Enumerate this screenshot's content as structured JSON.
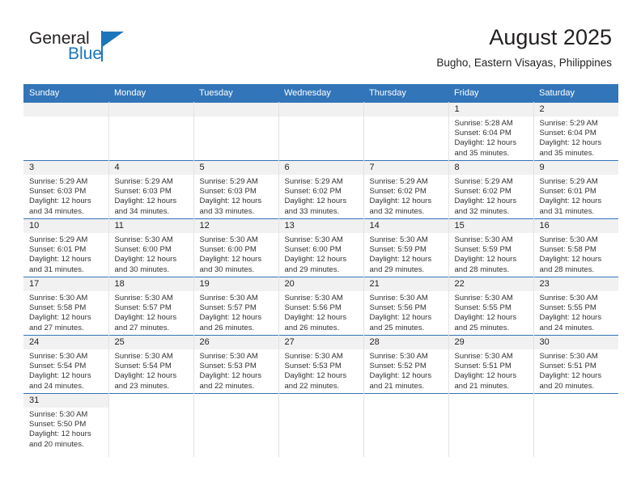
{
  "brand": {
    "name_part1": "General",
    "name_part2": "Blue",
    "logo_icon": "triangle-flag-icon",
    "accent_color": "#1b75bb"
  },
  "header": {
    "title": "August 2025",
    "subtitle": "Bugho, Eastern Visayas, Philippines"
  },
  "theme": {
    "header_row_bg": "#3275b8",
    "daynum_band_bg": "#f1f1f1",
    "grid_line": "#3275b8",
    "text": "#231f20"
  },
  "calendar": {
    "weekday_headers": [
      "Sunday",
      "Monday",
      "Tuesday",
      "Wednesday",
      "Thursday",
      "Friday",
      "Saturday"
    ],
    "weeks": [
      [
        {
          "day": "",
          "empty": true
        },
        {
          "day": "",
          "empty": true
        },
        {
          "day": "",
          "empty": true
        },
        {
          "day": "",
          "empty": true
        },
        {
          "day": "",
          "empty": true
        },
        {
          "day": "1",
          "sunrise": "Sunrise: 5:28 AM",
          "sunset": "Sunset: 6:04 PM",
          "daylight1": "Daylight: 12 hours",
          "daylight2": "and 35 minutes."
        },
        {
          "day": "2",
          "sunrise": "Sunrise: 5:29 AM",
          "sunset": "Sunset: 6:04 PM",
          "daylight1": "Daylight: 12 hours",
          "daylight2": "and 35 minutes."
        }
      ],
      [
        {
          "day": "3",
          "sunrise": "Sunrise: 5:29 AM",
          "sunset": "Sunset: 6:03 PM",
          "daylight1": "Daylight: 12 hours",
          "daylight2": "and 34 minutes."
        },
        {
          "day": "4",
          "sunrise": "Sunrise: 5:29 AM",
          "sunset": "Sunset: 6:03 PM",
          "daylight1": "Daylight: 12 hours",
          "daylight2": "and 34 minutes."
        },
        {
          "day": "5",
          "sunrise": "Sunrise: 5:29 AM",
          "sunset": "Sunset: 6:03 PM",
          "daylight1": "Daylight: 12 hours",
          "daylight2": "and 33 minutes."
        },
        {
          "day": "6",
          "sunrise": "Sunrise: 5:29 AM",
          "sunset": "Sunset: 6:02 PM",
          "daylight1": "Daylight: 12 hours",
          "daylight2": "and 33 minutes."
        },
        {
          "day": "7",
          "sunrise": "Sunrise: 5:29 AM",
          "sunset": "Sunset: 6:02 PM",
          "daylight1": "Daylight: 12 hours",
          "daylight2": "and 32 minutes."
        },
        {
          "day": "8",
          "sunrise": "Sunrise: 5:29 AM",
          "sunset": "Sunset: 6:02 PM",
          "daylight1": "Daylight: 12 hours",
          "daylight2": "and 32 minutes."
        },
        {
          "day": "9",
          "sunrise": "Sunrise: 5:29 AM",
          "sunset": "Sunset: 6:01 PM",
          "daylight1": "Daylight: 12 hours",
          "daylight2": "and 31 minutes."
        }
      ],
      [
        {
          "day": "10",
          "sunrise": "Sunrise: 5:29 AM",
          "sunset": "Sunset: 6:01 PM",
          "daylight1": "Daylight: 12 hours",
          "daylight2": "and 31 minutes."
        },
        {
          "day": "11",
          "sunrise": "Sunrise: 5:30 AM",
          "sunset": "Sunset: 6:00 PM",
          "daylight1": "Daylight: 12 hours",
          "daylight2": "and 30 minutes."
        },
        {
          "day": "12",
          "sunrise": "Sunrise: 5:30 AM",
          "sunset": "Sunset: 6:00 PM",
          "daylight1": "Daylight: 12 hours",
          "daylight2": "and 30 minutes."
        },
        {
          "day": "13",
          "sunrise": "Sunrise: 5:30 AM",
          "sunset": "Sunset: 6:00 PM",
          "daylight1": "Daylight: 12 hours",
          "daylight2": "and 29 minutes."
        },
        {
          "day": "14",
          "sunrise": "Sunrise: 5:30 AM",
          "sunset": "Sunset: 5:59 PM",
          "daylight1": "Daylight: 12 hours",
          "daylight2": "and 29 minutes."
        },
        {
          "day": "15",
          "sunrise": "Sunrise: 5:30 AM",
          "sunset": "Sunset: 5:59 PM",
          "daylight1": "Daylight: 12 hours",
          "daylight2": "and 28 minutes."
        },
        {
          "day": "16",
          "sunrise": "Sunrise: 5:30 AM",
          "sunset": "Sunset: 5:58 PM",
          "daylight1": "Daylight: 12 hours",
          "daylight2": "and 28 minutes."
        }
      ],
      [
        {
          "day": "17",
          "sunrise": "Sunrise: 5:30 AM",
          "sunset": "Sunset: 5:58 PM",
          "daylight1": "Daylight: 12 hours",
          "daylight2": "and 27 minutes."
        },
        {
          "day": "18",
          "sunrise": "Sunrise: 5:30 AM",
          "sunset": "Sunset: 5:57 PM",
          "daylight1": "Daylight: 12 hours",
          "daylight2": "and 27 minutes."
        },
        {
          "day": "19",
          "sunrise": "Sunrise: 5:30 AM",
          "sunset": "Sunset: 5:57 PM",
          "daylight1": "Daylight: 12 hours",
          "daylight2": "and 26 minutes."
        },
        {
          "day": "20",
          "sunrise": "Sunrise: 5:30 AM",
          "sunset": "Sunset: 5:56 PM",
          "daylight1": "Daylight: 12 hours",
          "daylight2": "and 26 minutes."
        },
        {
          "day": "21",
          "sunrise": "Sunrise: 5:30 AM",
          "sunset": "Sunset: 5:56 PM",
          "daylight1": "Daylight: 12 hours",
          "daylight2": "and 25 minutes."
        },
        {
          "day": "22",
          "sunrise": "Sunrise: 5:30 AM",
          "sunset": "Sunset: 5:55 PM",
          "daylight1": "Daylight: 12 hours",
          "daylight2": "and 25 minutes."
        },
        {
          "day": "23",
          "sunrise": "Sunrise: 5:30 AM",
          "sunset": "Sunset: 5:55 PM",
          "daylight1": "Daylight: 12 hours",
          "daylight2": "and 24 minutes."
        }
      ],
      [
        {
          "day": "24",
          "sunrise": "Sunrise: 5:30 AM",
          "sunset": "Sunset: 5:54 PM",
          "daylight1": "Daylight: 12 hours",
          "daylight2": "and 24 minutes."
        },
        {
          "day": "25",
          "sunrise": "Sunrise: 5:30 AM",
          "sunset": "Sunset: 5:54 PM",
          "daylight1": "Daylight: 12 hours",
          "daylight2": "and 23 minutes."
        },
        {
          "day": "26",
          "sunrise": "Sunrise: 5:30 AM",
          "sunset": "Sunset: 5:53 PM",
          "daylight1": "Daylight: 12 hours",
          "daylight2": "and 22 minutes."
        },
        {
          "day": "27",
          "sunrise": "Sunrise: 5:30 AM",
          "sunset": "Sunset: 5:53 PM",
          "daylight1": "Daylight: 12 hours",
          "daylight2": "and 22 minutes."
        },
        {
          "day": "28",
          "sunrise": "Sunrise: 5:30 AM",
          "sunset": "Sunset: 5:52 PM",
          "daylight1": "Daylight: 12 hours",
          "daylight2": "and 21 minutes."
        },
        {
          "day": "29",
          "sunrise": "Sunrise: 5:30 AM",
          "sunset": "Sunset: 5:51 PM",
          "daylight1": "Daylight: 12 hours",
          "daylight2": "and 21 minutes."
        },
        {
          "day": "30",
          "sunrise": "Sunrise: 5:30 AM",
          "sunset": "Sunset: 5:51 PM",
          "daylight1": "Daylight: 12 hours",
          "daylight2": "and 20 minutes."
        }
      ],
      [
        {
          "day": "31",
          "sunrise": "Sunrise: 5:30 AM",
          "sunset": "Sunset: 5:50 PM",
          "daylight1": "Daylight: 12 hours",
          "daylight2": "and 20 minutes."
        },
        {
          "day": "",
          "empty": true,
          "blank": true
        },
        {
          "day": "",
          "empty": true,
          "blank": true
        },
        {
          "day": "",
          "empty": true,
          "blank": true
        },
        {
          "day": "",
          "empty": true,
          "blank": true
        },
        {
          "day": "",
          "empty": true,
          "blank": true
        },
        {
          "day": "",
          "empty": true,
          "blank": true
        }
      ]
    ]
  }
}
